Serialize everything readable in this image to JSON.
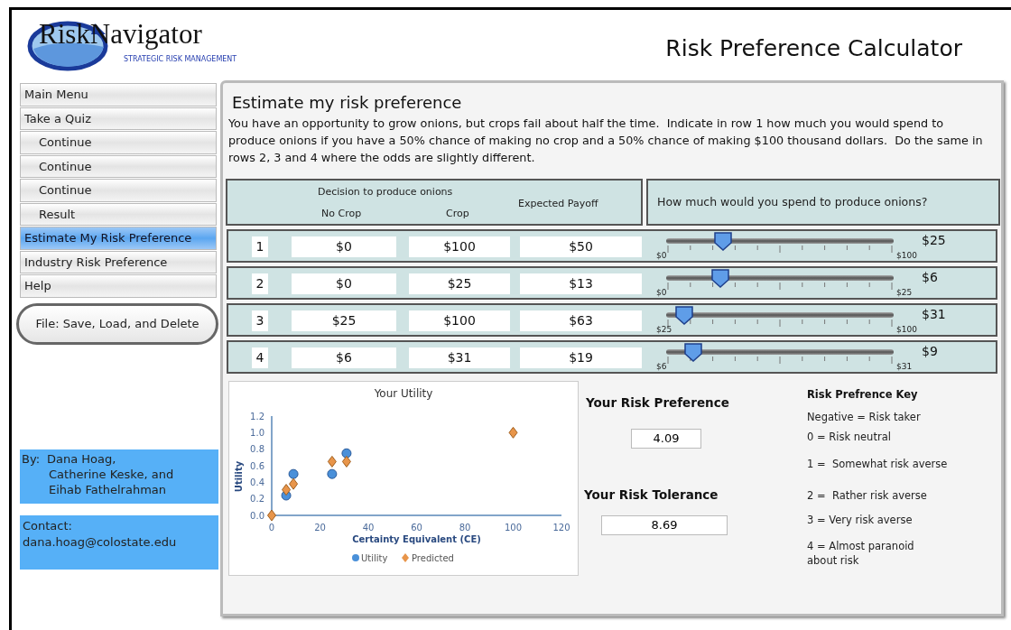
{
  "header": {
    "logo_title": "RiskNavigator",
    "logo_subtitle": "STRATEGIC RISK MANAGEMENT",
    "title": "Risk Preference Calculator"
  },
  "sidebar": {
    "items": [
      {
        "label": "Main Menu",
        "selected": false
      },
      {
        "label": "Take a Quiz",
        "selected": false,
        "children": [
          {
            "label": "Continue",
            "selected": false
          },
          {
            "label": "Continue",
            "selected": false
          },
          {
            "label": "Continue",
            "selected": false
          },
          {
            "label": "Result",
            "selected": false
          }
        ]
      },
      {
        "label": "Estimate My Risk Preference",
        "selected": true
      },
      {
        "label": "Industry Risk Preference",
        "selected": false
      },
      {
        "label": "Help",
        "selected": false
      }
    ],
    "file_button": "File: Save, Load, and Delete",
    "authors": [
      "By:",
      "Dana Hoag,",
      "Catherine Keske, and",
      "Eihab Fathelrahman"
    ],
    "contact": [
      "Contact:",
      "dana.hoag@colostate.edu"
    ]
  },
  "main": {
    "title": "Estimate my risk preference",
    "intro": "You have an opportunity to grow onions, but crops fail about half the time.  Indicate in row 1 how much you would spend to produce onions if you have a 50% chance of making no crop and a 50% chance of making $100 thousand dollars.  Do the same in rows 2, 3 and 4 where the odds are slightly different.",
    "table": {
      "group_heading": "Decision to produce onions",
      "columns": [
        "No Crop",
        "Crop",
        "Expected Payoff"
      ],
      "slider_heading": "How much would you spend to produce onions?",
      "rows": [
        {
          "number": "1",
          "no_crop": "$0",
          "crop": "$100",
          "expected_payoff": "$50",
          "min": "$0",
          "max": "$100",
          "level": 0.25,
          "reading": "$25"
        },
        {
          "number": "2",
          "no_crop": "$0",
          "crop": "$25",
          "expected_payoff": "$13",
          "min": "$0",
          "max": "$25",
          "level": 0.24,
          "reading": "$6"
        },
        {
          "number": "3",
          "no_crop": "$25",
          "crop": "$100",
          "expected_payoff": "$63",
          "min": "$25",
          "max": "$100",
          "level": 0.08,
          "reading": "$31"
        },
        {
          "number": "4",
          "no_crop": "$6",
          "crop": "$31",
          "expected_payoff": "$19",
          "min": "$6",
          "max": "$31",
          "level": 0.12,
          "reading": "$9"
        }
      ]
    },
    "utility_chart": {
      "chart_data": {
        "type": "scatter",
        "title": "Your Utility",
        "xlabel": "Certainty Equivalent (CE)",
        "ylabel": "Utility",
        "x": [
          0,
          6,
          9,
          25,
          31,
          100
        ],
        "series": [
          {
            "name": "Utility",
            "color": "#4a90d9",
            "values": [
              null,
              0.24,
              0.5,
              0.5,
              0.75,
              null
            ]
          },
          {
            "name": "Predicted",
            "color": "#e8954a",
            "values": [
              0,
              0.31,
              0.38,
              0.65,
              0.65,
              1.0
            ]
          }
        ],
        "xlim": [
          0,
          120
        ],
        "ylim": [
          0,
          1.2
        ],
        "legend": "bottom",
        "xticks": [
          {
            "value": 0,
            "label": "0"
          },
          20,
          40,
          60,
          80,
          100,
          120
        ],
        "yticks": [
          {
            "value": 0,
            "label": "0.0"
          },
          0.2,
          0.4,
          0.6,
          0.8,
          {
            "value": 1,
            "label": "1.0"
          },
          1.2
        ]
      }
    },
    "risk_preference": {
      "label": "Your Risk Preference",
      "value": "4.09"
    },
    "risk_tolerance": {
      "label": "Your Risk Tolerance",
      "value": "8.69"
    },
    "key": {
      "title": "Risk Prefrence Key",
      "entries": [
        "Negative = Risk taker",
        "0 = Risk neutral",
        "1 =  Somewhat risk averse",
        "2 =  Rather risk averse",
        "3 = Very risk averse",
        "4 = Almost paranoid about risk"
      ]
    }
  }
}
